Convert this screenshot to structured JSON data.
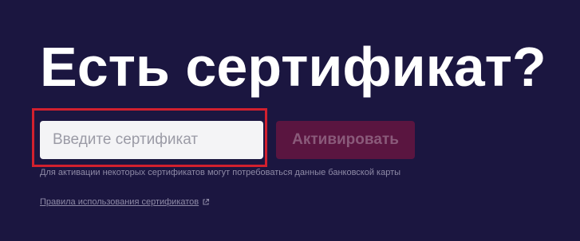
{
  "heading": {
    "title": "Есть сертификат?"
  },
  "form": {
    "input_placeholder": "Введите сертификат",
    "input_value": "",
    "activate_label": "Активировать"
  },
  "note": {
    "text": "Для активации некоторых сертификатов могут потребоваться данные банковской карты"
  },
  "links": {
    "rules_label": "Правила использования сертификатов",
    "rules_icon": "external-link-icon"
  },
  "colors": {
    "background": "#1b1640",
    "title": "#ffffff",
    "highlight_border": "#d2202e",
    "button_bg": "#5a1540",
    "button_text": "#8a5a7a",
    "muted_text": "#8e8aa6"
  }
}
